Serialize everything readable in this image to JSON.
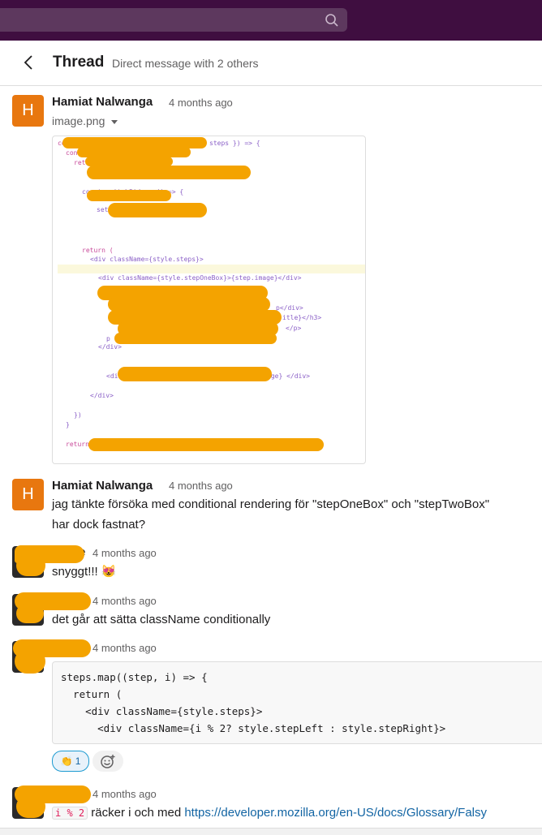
{
  "header": {
    "title": "Thread",
    "subtitle": "Direct message with 2 others"
  },
  "messages": [
    {
      "author": "Hamiat Nalwanga",
      "avatar_letter": "H",
      "time": "4 months ago",
      "file_name": "image.png",
      "code_lines": [
        "const",
        "steps }) => {",
        "const",
        "return (",
        "const switchSide = () => {",
        "setS",
        "return (",
        "<div className={style.steps}>",
        "<div className={style.stepOneBox}>{step.image}</div>",
        "p</div>",
        "itle}</h3>",
        "</p>",
        "p",
        "</div>",
        "<div",
        "age} </div>",
        "</div>",
        "})",
        "}",
        "return"
      ]
    },
    {
      "author": "Hamiat Nalwanga",
      "avatar_letter": "H",
      "time": "4 months ago",
      "text_line1": "jag tänkte försöka med conditional rendering för \"stepOneBox\" och \"stepTwoBox\"",
      "text_line2": "har dock fastnat?"
    },
    {
      "author_partial": "e",
      "time": "4 months ago",
      "text": "snyggt!!!",
      "emoji": "😻"
    },
    {
      "time": "4 months ago",
      "text": "det går att sätta className conditionally"
    },
    {
      "time": "4 months ago",
      "code": "steps.map((step, i) => {\n  return (\n    <div className={style.steps}>\n      <div className={i % 2? style.stepLeft : style.stepRight}>",
      "reaction_emoji": "👏",
      "reaction_count": "1"
    },
    {
      "time": "4 months ago",
      "inline_code": "i % 2",
      "text": "räcker i och med",
      "link": "https://developer.mozilla.org/en-US/docs/Glossary/Falsy"
    }
  ],
  "icons": {
    "search": "search-icon",
    "back": "chevron-left-icon",
    "file_caret": "caret-down-icon",
    "add_reaction": "add-reaction-icon"
  },
  "colors": {
    "topbar": "#3f0e40",
    "avatar": "#e8770f",
    "link": "#1264a3",
    "redaction": "#f4a300"
  }
}
